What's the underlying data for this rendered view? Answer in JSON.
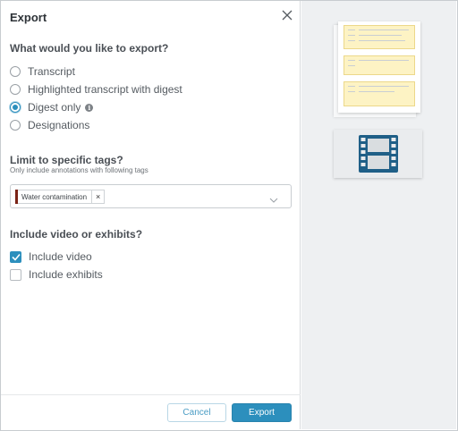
{
  "dialog": {
    "title": "Export",
    "close_icon": "close-icon"
  },
  "export_type": {
    "heading": "What would you like to export?",
    "options": [
      {
        "label": "Transcript",
        "selected": false
      },
      {
        "label": "Highlighted transcript with digest",
        "selected": false
      },
      {
        "label": "Digest only",
        "selected": true,
        "info_icon": "info-icon"
      },
      {
        "label": "Designations",
        "selected": false
      }
    ]
  },
  "tags": {
    "heading": "Limit to specific tags?",
    "subtext": "Only include annotations with following tags",
    "selected": [
      {
        "label": "Water contamination",
        "color": "#7b2417",
        "remove_symbol": "×"
      }
    ],
    "dropdown_icon": "chevron-down-icon"
  },
  "media": {
    "heading": "Include video or exhibits?",
    "options": [
      {
        "label": "Include video",
        "checked": true
      },
      {
        "label": "Include exhibits",
        "checked": false
      }
    ]
  },
  "footer": {
    "cancel_label": "Cancel",
    "export_label": "Export"
  },
  "preview": {
    "items": [
      "document-stack-preview",
      "film-icon"
    ]
  },
  "colors": {
    "accent": "#2c8fbd",
    "tag_color": "#7b2417",
    "highlight": "#fdf3c4",
    "film": "#1f5f87"
  }
}
